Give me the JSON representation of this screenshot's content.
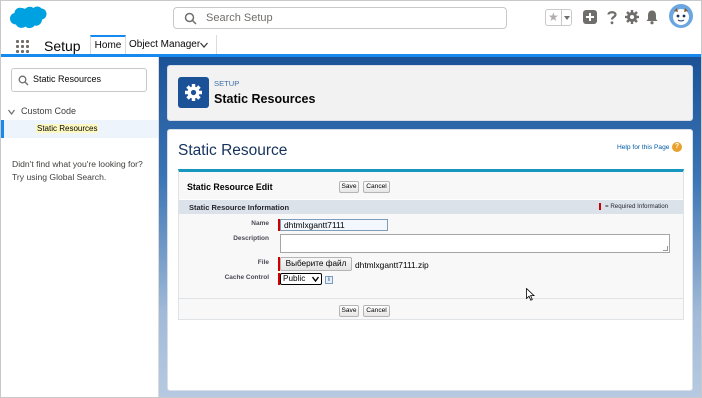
{
  "header": {
    "search_placeholder": "Search Setup"
  },
  "nav": {
    "app_name": "Setup",
    "tabs": [
      {
        "label": "Home"
      },
      {
        "label": "Object Manager"
      }
    ]
  },
  "sidebar": {
    "quick_find_value": "Static Resources",
    "tree_parent": "Custom Code",
    "tree_child": "Static Resources",
    "help_text": "Didn't find what you're looking for? Try using Global Search."
  },
  "page_header": {
    "overline": "SETUP",
    "title": "Static Resources"
  },
  "card": {
    "title": "Static Resource",
    "help_link": "Help for this Page",
    "help_icon": "?",
    "edit_title": "Static Resource Edit",
    "save_label": "Save",
    "cancel_label": "Cancel",
    "section_title": "Static Resource Information",
    "required_info": "= Required Information",
    "fields": {
      "name_label": "Name",
      "name_value": "dhtmlxgantt7111",
      "description_label": "Description",
      "description_value": "",
      "file_label": "File",
      "file_button": "Выберите файл",
      "file_name": "dhtmlxgantt7111.zip",
      "cache_label": "Cache Control",
      "cache_value": "Public",
      "info_icon": "i"
    }
  },
  "colors": {
    "brand_blue": "#1589ee",
    "required_red": "#cc0000",
    "section_bar": "#dbe2ea"
  },
  "icons": [
    "salesforce-cloud-logo",
    "search-icon",
    "favorites-star-icon",
    "add-icon",
    "help-icon",
    "gear-icon",
    "bell-icon",
    "astro-avatar",
    "app-launcher-icon",
    "chevron-down-icon",
    "setup-gear-icon",
    "info-icon",
    "mouse-cursor"
  ]
}
